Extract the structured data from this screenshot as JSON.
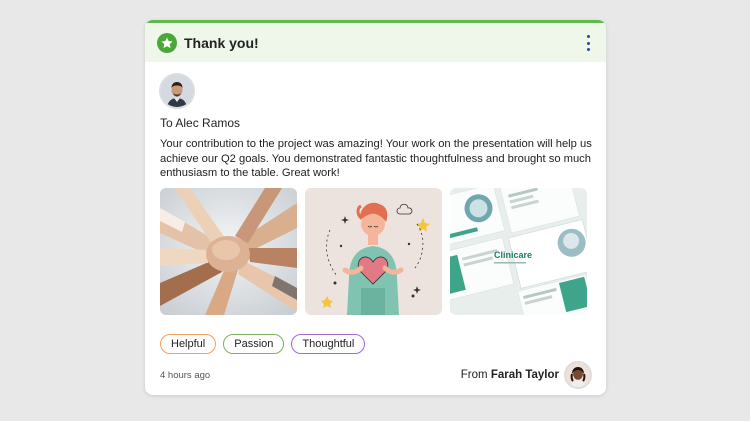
{
  "card": {
    "title": "Thank you!",
    "header_icon": "star-icon",
    "menu_icon": "kebab-menu-icon",
    "recipient": {
      "to_prefix": "To",
      "name": "Alec Ramos"
    },
    "message": "Your contribution to the project was amazing! Your work on the presentation will help us achieve our Q2 goals. You demonstrated fantastic thoughtfulness and brought so much enthusiasm to the table. Great work!",
    "photos": [
      {
        "name": "team-hands-photo"
      },
      {
        "name": "heart-illustration"
      },
      {
        "name": "clinicare-presentation",
        "brand_text": "Clinicare"
      }
    ],
    "tags": [
      {
        "label": "Helpful",
        "color": "#f0a060"
      },
      {
        "label": "Passion",
        "color": "#7bb35a"
      },
      {
        "label": "Thoughtful",
        "color": "#a46ad0"
      }
    ],
    "timestamp": "4 hours ago",
    "sender": {
      "from_prefix": "From",
      "name": "Farah Taylor"
    }
  },
  "colors": {
    "accent": "#5cbb4a",
    "header_bg": "#eef7ea",
    "menu_dots": "#2a4a9e"
  }
}
